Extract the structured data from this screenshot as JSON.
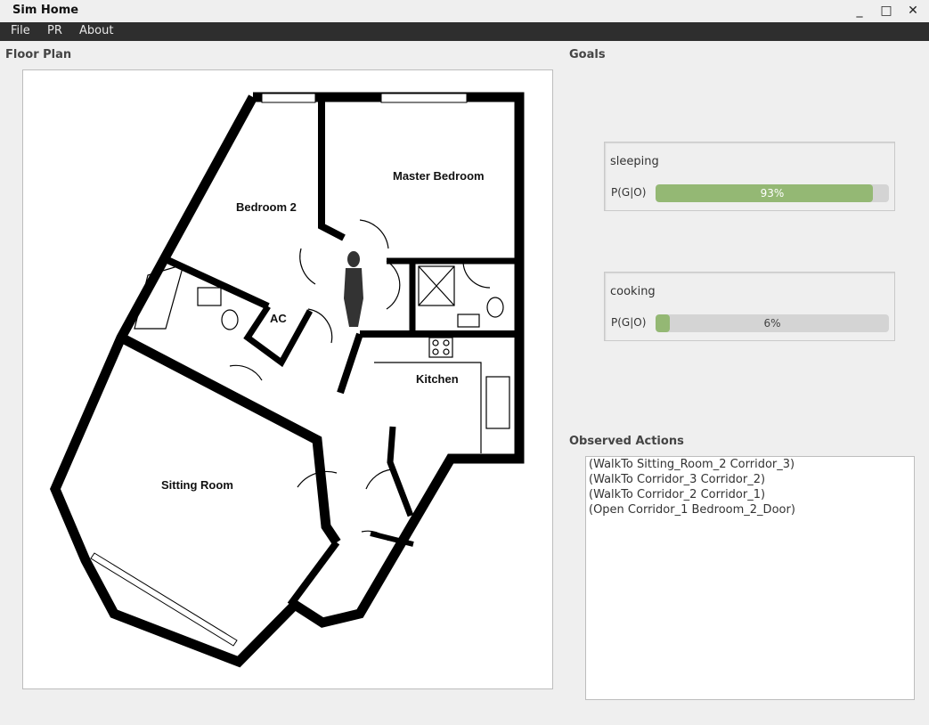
{
  "window": {
    "title": "Sim Home",
    "minimize_glyph": "_",
    "maximize_glyph": "□",
    "close_glyph": "✕"
  },
  "menu": [
    "File",
    "PR",
    "About"
  ],
  "floor_plan": {
    "label": "Floor Plan",
    "rooms": {
      "master_bedroom": "Master Bedroom",
      "bedroom_2": "Bedroom 2",
      "ac": "AC",
      "kitchen": "Kitchen",
      "sitting_room": "Sitting Room"
    }
  },
  "goals": {
    "label": "Goals",
    "items": [
      {
        "name": "sleeping",
        "metric": "P(G|O)",
        "value": 0.93,
        "display": "93%"
      },
      {
        "name": "cooking",
        "metric": "P(G|O)",
        "value": 0.06,
        "display": "6%"
      }
    ]
  },
  "observed_actions": {
    "label": "Observed Actions",
    "items": [
      "(WalkTo Sitting_Room_2 Corridor_3)",
      "(WalkTo Corridor_3 Corridor_2)",
      "(WalkTo Corridor_2 Corridor_1)",
      "(Open Corridor_1 Bedroom_2_Door)"
    ]
  },
  "colors": {
    "progress_fill": "#94b874",
    "progress_track": "#d4d4d4",
    "menubar": "#2e2e2e"
  }
}
